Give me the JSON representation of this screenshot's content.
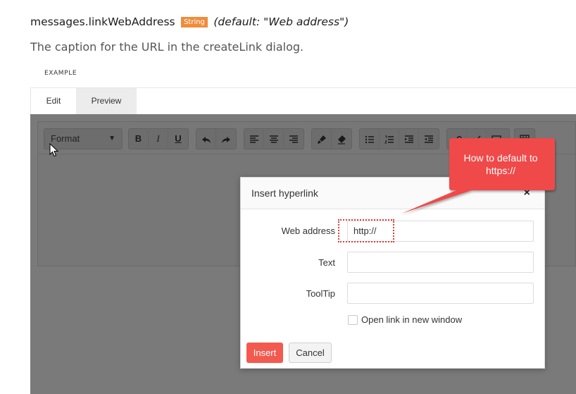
{
  "doc": {
    "property_name": "messages.linkWebAddress",
    "type_badge": "String",
    "default_text": "(default: \"Web address\")",
    "description": "The caption for the URL in the createLink dialog.",
    "example_label": "EXAMPLE"
  },
  "tabs": [
    {
      "label": "Edit"
    },
    {
      "label": "Preview"
    }
  ],
  "editor": {
    "format_select": "Format",
    "toolbar_icons": [
      "bold-icon",
      "italic-icon",
      "underline-icon",
      "undo-icon",
      "redo-icon",
      "align-left-icon",
      "align-center-icon",
      "align-right-icon",
      "format-brush-icon",
      "clean-formatting-icon",
      "bullet-list-icon",
      "numbered-list-icon",
      "indent-icon",
      "outdent-icon",
      "link-icon",
      "unlink-icon",
      "image-icon",
      "table-icon"
    ],
    "toolbar_labels": {
      "bold": "B",
      "italic": "I",
      "underline": "U"
    }
  },
  "dialog": {
    "title": "Insert hyperlink",
    "close": "×",
    "fields": [
      {
        "label": "Web address",
        "value": "http://"
      },
      {
        "label": "Text",
        "value": ""
      },
      {
        "label": "ToolTip",
        "value": ""
      }
    ],
    "checkbox_label": "Open link in new window",
    "checkbox_checked": false,
    "insert_label": "Insert",
    "cancel_label": "Cancel"
  },
  "callout": {
    "line1": "How to default to",
    "line2": "https://"
  },
  "colors": {
    "badge": "#f08c3a",
    "insert_button": "#f35a4f",
    "callout": "#f04a4a",
    "overlay": "#7a7a7a"
  }
}
